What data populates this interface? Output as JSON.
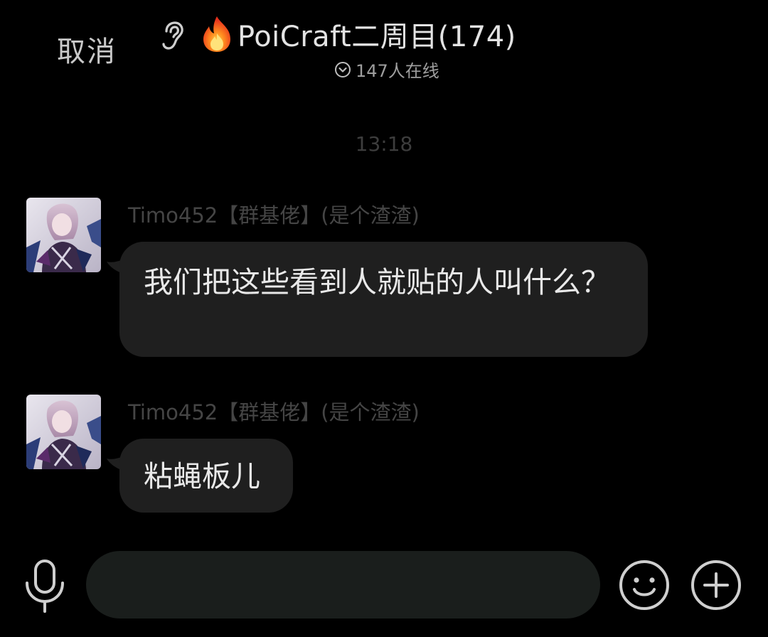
{
  "header": {
    "cancel_label": "取消",
    "ear_icon": "ear-icon",
    "fire_icon": "fire-emoji-icon",
    "title": "PoiCraft二周目(174)",
    "online_icon": "chevron-down-circle-icon",
    "online_text": "147人在线"
  },
  "chat": {
    "timestamp": "13:18",
    "messages": [
      {
        "sender": "Timo452【群基佬】(是个渣渣)",
        "text": "我们把这些看到人就贴的人叫什么？",
        "avatar": "anime-character-avatar"
      },
      {
        "sender": "Timo452【群基佬】(是个渣渣)",
        "text": "粘蝇板儿",
        "avatar": "anime-character-avatar"
      }
    ]
  },
  "input_bar": {
    "mic_icon": "microphone-icon",
    "input_value": "",
    "input_placeholder": "",
    "emoji_icon": "smiley-icon",
    "plus_icon": "plus-circle-icon"
  },
  "colors": {
    "background": "#000000",
    "bubble": "#1f1f1f",
    "input_field": "#1a1e1c",
    "sender_text": "#454545",
    "timestamp_text": "#3d3d3d"
  }
}
